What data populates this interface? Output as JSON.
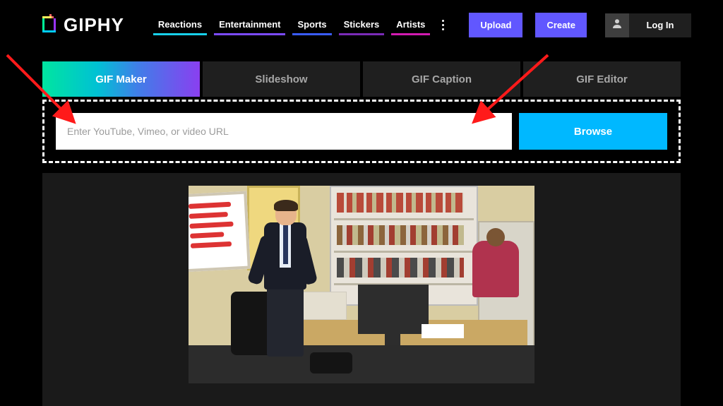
{
  "brand": {
    "name": "GIPHY"
  },
  "nav": {
    "items": [
      {
        "label": "Reactions",
        "color": "#17d0ea"
      },
      {
        "label": "Entertainment",
        "color": "#7b4bff"
      },
      {
        "label": "Sports",
        "color": "#3a5cff"
      },
      {
        "label": "Stickers",
        "color": "#7a2bb8"
      },
      {
        "label": "Artists",
        "color": "#d21bb0"
      }
    ]
  },
  "header_buttons": {
    "upload": "Upload",
    "create": "Create",
    "login": "Log In"
  },
  "tabs": [
    {
      "label": "GIF Maker",
      "active": true
    },
    {
      "label": "Slideshow",
      "active": false
    },
    {
      "label": "GIF Caption",
      "active": false
    },
    {
      "label": "GIF Editor",
      "active": false
    }
  ],
  "url_area": {
    "placeholder": "Enter YouTube, Vimeo, or video URL",
    "value": "",
    "browse": "Browse"
  }
}
